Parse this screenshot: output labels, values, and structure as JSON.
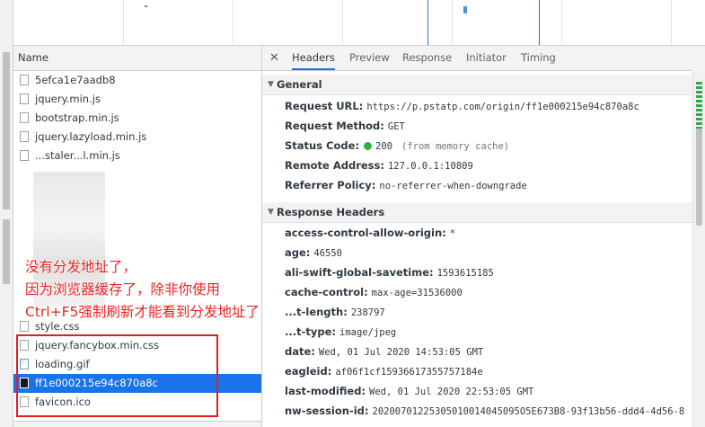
{
  "network": {
    "column_header": "Name",
    "requests": [
      {
        "name": "5efca1e7aadb8",
        "icon": "document-icon"
      },
      {
        "name": "jquery.min.js",
        "icon": "document-icon"
      },
      {
        "name": "bootstrap.min.js",
        "icon": "document-icon"
      },
      {
        "name": "jquery.lazyload.min.js",
        "icon": "document-icon"
      },
      {
        "name": "...staler...l.min.js",
        "icon": "document-icon"
      },
      {
        "name": "style.css",
        "icon": "document-icon"
      },
      {
        "name": "jquery.fancybox.min.css",
        "icon": "document-icon"
      },
      {
        "name": "loading.gif",
        "icon": "image-icon"
      },
      {
        "name": "ff1e000215e94c870a8c",
        "icon": "image-icon",
        "selected": true
      },
      {
        "name": "favicon.ico",
        "icon": "document-icon"
      }
    ]
  },
  "details": {
    "close_label": "✕",
    "tabs": [
      {
        "label": "Headers",
        "active": true
      },
      {
        "label": "Preview"
      },
      {
        "label": "Response"
      },
      {
        "label": "Initiator"
      },
      {
        "label": "Timing"
      }
    ],
    "general": {
      "title": "General",
      "fields": [
        {
          "key": "Request URL:",
          "value": "https://p.pstatp.com/origin/ff1e000215e94c870a8c"
        },
        {
          "key": "Request Method:",
          "value": "GET"
        },
        {
          "key": "Status Code:",
          "value": "200",
          "note": "(from memory cache)",
          "status_color": "#2db341"
        },
        {
          "key": "Remote Address:",
          "value": "127.0.0.1:10809"
        },
        {
          "key": "Referrer Policy:",
          "value": "no-referrer-when-downgrade"
        }
      ]
    },
    "response_headers": {
      "title": "Response Headers",
      "fields": [
        {
          "key": "access-control-allow-origin:",
          "value": "*"
        },
        {
          "key": "age:",
          "value": "46550"
        },
        {
          "key": "ali-swift-global-savetime:",
          "value": "1593615185"
        },
        {
          "key": "cache-control:",
          "value": "max-age=31536000"
        },
        {
          "key": "...t-length:",
          "value": "238797"
        },
        {
          "key": "...t-type:",
          "value": "image/jpeg"
        },
        {
          "key": "date:",
          "value": "Wed, 01 Jul 2020 14:53:05 GMT"
        },
        {
          "key": "eagleid:",
          "value": "af06f1cf15936617355757184e"
        },
        {
          "key": "last-modified:",
          "value": "Wed, 01 Jul 2020 22:53:05 GMT"
        },
        {
          "key": "nw-session-id:",
          "value": "20200701225305010014045095O5E673B8-93f13b56-ddd4-4d56-8"
        }
      ]
    }
  },
  "annotation": {
    "lines": [
      "没有分发地址了，",
      "因为浏览器缓存了，除非你使用",
      "Ctrl+F5强制刷新才能看到分发地址了"
    ],
    "color": "#ee2222"
  },
  "colors": {
    "accent": "#1a73e8",
    "status_ok": "#2db341",
    "annotation": "#ee2222"
  }
}
